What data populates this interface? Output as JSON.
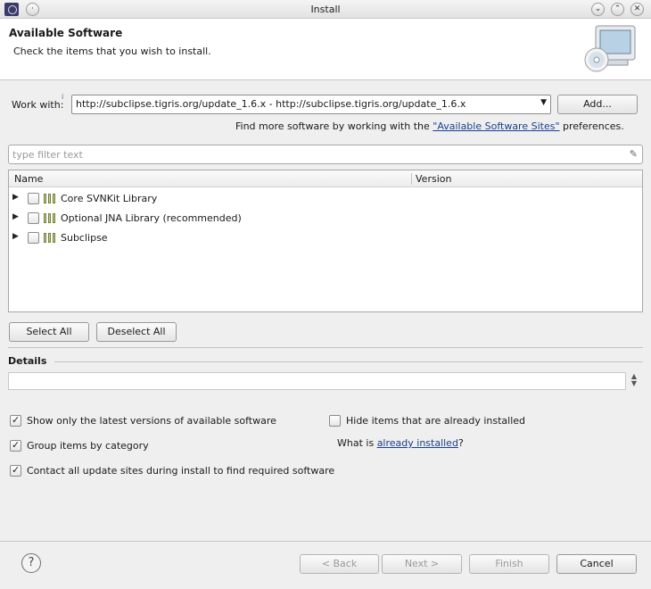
{
  "window": {
    "title": "Install",
    "controls": [
      "minimize",
      "maximize",
      "close"
    ]
  },
  "header": {
    "title": "Available Software",
    "description": "Check the items that you wish to install."
  },
  "work_with": {
    "label": "Work with:",
    "value": "http://subclipse.tigris.org/update_1.6.x - http://subclipse.tigris.org/update_1.6.x",
    "add_button": "Add...",
    "hint_prefix": "Find more software by working with the ",
    "hint_link": "\"Available Software Sites\"",
    "hint_suffix": " preferences."
  },
  "filter": {
    "placeholder": "type filter text"
  },
  "tree": {
    "columns": [
      "Name",
      "Version"
    ],
    "items": [
      {
        "label": "Core SVNKit Library",
        "version": "",
        "checked": false
      },
      {
        "label": "Optional JNA Library (recommended)",
        "version": "",
        "checked": false
      },
      {
        "label": "Subclipse",
        "version": "",
        "checked": false
      }
    ]
  },
  "selection_buttons": {
    "select_all": "Select All",
    "deselect_all": "Deselect All"
  },
  "details": {
    "title": "Details",
    "text": ""
  },
  "options": {
    "show_latest": {
      "label": "Show only the latest versions of available software",
      "checked": true
    },
    "group_by_category": {
      "label": "Group items by category",
      "checked": true
    },
    "contact_sites": {
      "label": "Contact all update sites during install to find required software",
      "checked": true
    },
    "hide_installed": {
      "label": "Hide items that are already installed",
      "checked": false
    },
    "what_is_prefix": "What is ",
    "what_is_link": "already installed",
    "what_is_suffix": "?"
  },
  "footer": {
    "back": "< Back",
    "next": "Next >",
    "finish": "Finish",
    "cancel": "Cancel"
  }
}
